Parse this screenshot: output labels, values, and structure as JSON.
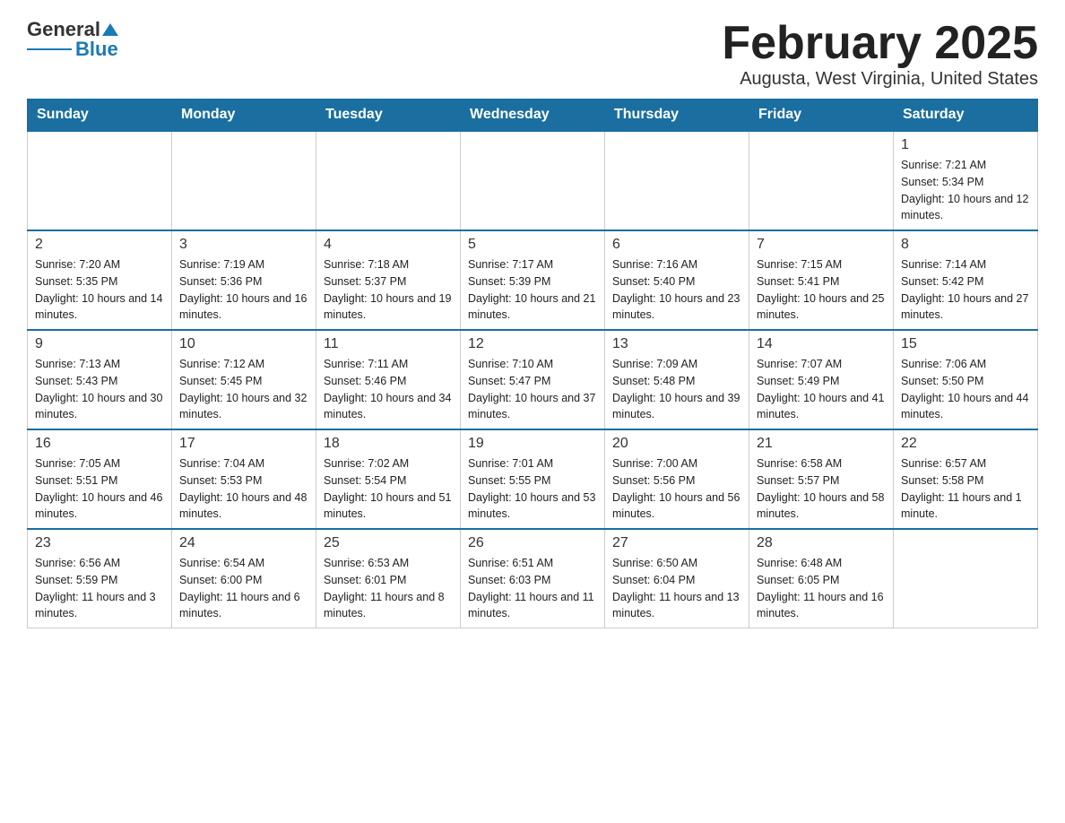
{
  "header": {
    "logo": {
      "general": "General",
      "blue": "Blue"
    },
    "title": "February 2025",
    "subtitle": "Augusta, West Virginia, United States"
  },
  "days_of_week": [
    "Sunday",
    "Monday",
    "Tuesday",
    "Wednesday",
    "Thursday",
    "Friday",
    "Saturday"
  ],
  "weeks": [
    [
      {
        "day": "",
        "sunrise": "",
        "sunset": "",
        "daylight": "",
        "empty": true
      },
      {
        "day": "",
        "sunrise": "",
        "sunset": "",
        "daylight": "",
        "empty": true
      },
      {
        "day": "",
        "sunrise": "",
        "sunset": "",
        "daylight": "",
        "empty": true
      },
      {
        "day": "",
        "sunrise": "",
        "sunset": "",
        "daylight": "",
        "empty": true
      },
      {
        "day": "",
        "sunrise": "",
        "sunset": "",
        "daylight": "",
        "empty": true
      },
      {
        "day": "",
        "sunrise": "",
        "sunset": "",
        "daylight": "",
        "empty": true
      },
      {
        "day": "1",
        "sunrise": "Sunrise: 7:21 AM",
        "sunset": "Sunset: 5:34 PM",
        "daylight": "Daylight: 10 hours and 12 minutes.",
        "empty": false
      }
    ],
    [
      {
        "day": "2",
        "sunrise": "Sunrise: 7:20 AM",
        "sunset": "Sunset: 5:35 PM",
        "daylight": "Daylight: 10 hours and 14 minutes.",
        "empty": false
      },
      {
        "day": "3",
        "sunrise": "Sunrise: 7:19 AM",
        "sunset": "Sunset: 5:36 PM",
        "daylight": "Daylight: 10 hours and 16 minutes.",
        "empty": false
      },
      {
        "day": "4",
        "sunrise": "Sunrise: 7:18 AM",
        "sunset": "Sunset: 5:37 PM",
        "daylight": "Daylight: 10 hours and 19 minutes.",
        "empty": false
      },
      {
        "day": "5",
        "sunrise": "Sunrise: 7:17 AM",
        "sunset": "Sunset: 5:39 PM",
        "daylight": "Daylight: 10 hours and 21 minutes.",
        "empty": false
      },
      {
        "day": "6",
        "sunrise": "Sunrise: 7:16 AM",
        "sunset": "Sunset: 5:40 PM",
        "daylight": "Daylight: 10 hours and 23 minutes.",
        "empty": false
      },
      {
        "day": "7",
        "sunrise": "Sunrise: 7:15 AM",
        "sunset": "Sunset: 5:41 PM",
        "daylight": "Daylight: 10 hours and 25 minutes.",
        "empty": false
      },
      {
        "day": "8",
        "sunrise": "Sunrise: 7:14 AM",
        "sunset": "Sunset: 5:42 PM",
        "daylight": "Daylight: 10 hours and 27 minutes.",
        "empty": false
      }
    ],
    [
      {
        "day": "9",
        "sunrise": "Sunrise: 7:13 AM",
        "sunset": "Sunset: 5:43 PM",
        "daylight": "Daylight: 10 hours and 30 minutes.",
        "empty": false
      },
      {
        "day": "10",
        "sunrise": "Sunrise: 7:12 AM",
        "sunset": "Sunset: 5:45 PM",
        "daylight": "Daylight: 10 hours and 32 minutes.",
        "empty": false
      },
      {
        "day": "11",
        "sunrise": "Sunrise: 7:11 AM",
        "sunset": "Sunset: 5:46 PM",
        "daylight": "Daylight: 10 hours and 34 minutes.",
        "empty": false
      },
      {
        "day": "12",
        "sunrise": "Sunrise: 7:10 AM",
        "sunset": "Sunset: 5:47 PM",
        "daylight": "Daylight: 10 hours and 37 minutes.",
        "empty": false
      },
      {
        "day": "13",
        "sunrise": "Sunrise: 7:09 AM",
        "sunset": "Sunset: 5:48 PM",
        "daylight": "Daylight: 10 hours and 39 minutes.",
        "empty": false
      },
      {
        "day": "14",
        "sunrise": "Sunrise: 7:07 AM",
        "sunset": "Sunset: 5:49 PM",
        "daylight": "Daylight: 10 hours and 41 minutes.",
        "empty": false
      },
      {
        "day": "15",
        "sunrise": "Sunrise: 7:06 AM",
        "sunset": "Sunset: 5:50 PM",
        "daylight": "Daylight: 10 hours and 44 minutes.",
        "empty": false
      }
    ],
    [
      {
        "day": "16",
        "sunrise": "Sunrise: 7:05 AM",
        "sunset": "Sunset: 5:51 PM",
        "daylight": "Daylight: 10 hours and 46 minutes.",
        "empty": false
      },
      {
        "day": "17",
        "sunrise": "Sunrise: 7:04 AM",
        "sunset": "Sunset: 5:53 PM",
        "daylight": "Daylight: 10 hours and 48 minutes.",
        "empty": false
      },
      {
        "day": "18",
        "sunrise": "Sunrise: 7:02 AM",
        "sunset": "Sunset: 5:54 PM",
        "daylight": "Daylight: 10 hours and 51 minutes.",
        "empty": false
      },
      {
        "day": "19",
        "sunrise": "Sunrise: 7:01 AM",
        "sunset": "Sunset: 5:55 PM",
        "daylight": "Daylight: 10 hours and 53 minutes.",
        "empty": false
      },
      {
        "day": "20",
        "sunrise": "Sunrise: 7:00 AM",
        "sunset": "Sunset: 5:56 PM",
        "daylight": "Daylight: 10 hours and 56 minutes.",
        "empty": false
      },
      {
        "day": "21",
        "sunrise": "Sunrise: 6:58 AM",
        "sunset": "Sunset: 5:57 PM",
        "daylight": "Daylight: 10 hours and 58 minutes.",
        "empty": false
      },
      {
        "day": "22",
        "sunrise": "Sunrise: 6:57 AM",
        "sunset": "Sunset: 5:58 PM",
        "daylight": "Daylight: 11 hours and 1 minute.",
        "empty": false
      }
    ],
    [
      {
        "day": "23",
        "sunrise": "Sunrise: 6:56 AM",
        "sunset": "Sunset: 5:59 PM",
        "daylight": "Daylight: 11 hours and 3 minutes.",
        "empty": false
      },
      {
        "day": "24",
        "sunrise": "Sunrise: 6:54 AM",
        "sunset": "Sunset: 6:00 PM",
        "daylight": "Daylight: 11 hours and 6 minutes.",
        "empty": false
      },
      {
        "day": "25",
        "sunrise": "Sunrise: 6:53 AM",
        "sunset": "Sunset: 6:01 PM",
        "daylight": "Daylight: 11 hours and 8 minutes.",
        "empty": false
      },
      {
        "day": "26",
        "sunrise": "Sunrise: 6:51 AM",
        "sunset": "Sunset: 6:03 PM",
        "daylight": "Daylight: 11 hours and 11 minutes.",
        "empty": false
      },
      {
        "day": "27",
        "sunrise": "Sunrise: 6:50 AM",
        "sunset": "Sunset: 6:04 PM",
        "daylight": "Daylight: 11 hours and 13 minutes.",
        "empty": false
      },
      {
        "day": "28",
        "sunrise": "Sunrise: 6:48 AM",
        "sunset": "Sunset: 6:05 PM",
        "daylight": "Daylight: 11 hours and 16 minutes.",
        "empty": false
      },
      {
        "day": "",
        "sunrise": "",
        "sunset": "",
        "daylight": "",
        "empty": true
      }
    ]
  ]
}
